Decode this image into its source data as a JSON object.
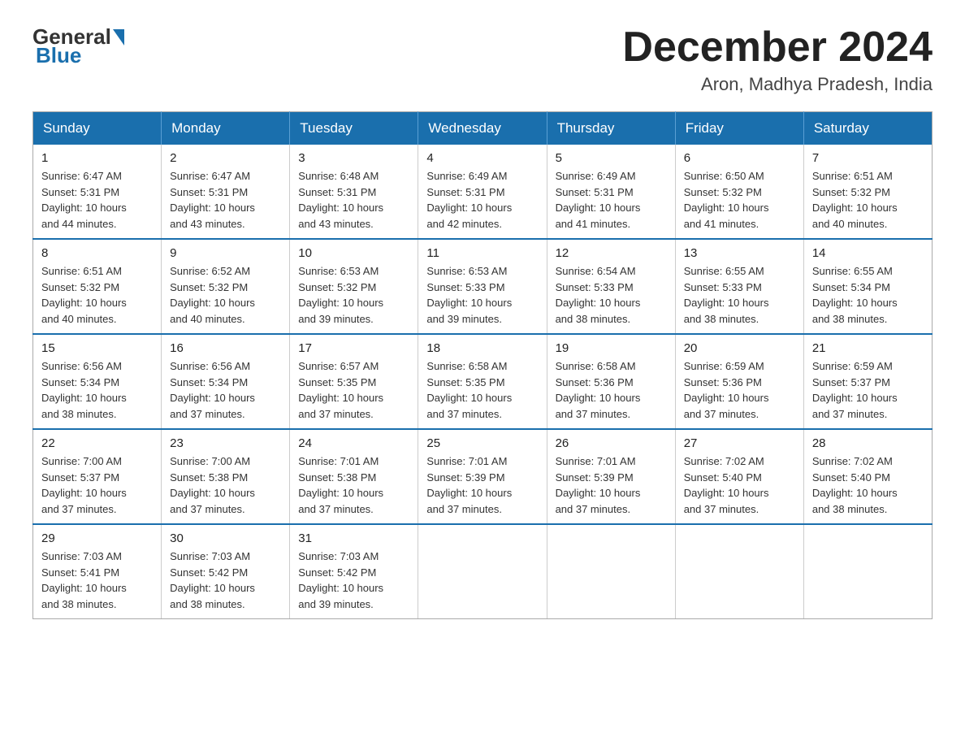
{
  "header": {
    "logo_general": "General",
    "logo_blue": "Blue",
    "month_title": "December 2024",
    "location": "Aron, Madhya Pradesh, India"
  },
  "weekdays": [
    "Sunday",
    "Monday",
    "Tuesday",
    "Wednesday",
    "Thursday",
    "Friday",
    "Saturday"
  ],
  "weeks": [
    [
      {
        "day": "1",
        "sunrise": "6:47 AM",
        "sunset": "5:31 PM",
        "daylight": "10 hours and 44 minutes."
      },
      {
        "day": "2",
        "sunrise": "6:47 AM",
        "sunset": "5:31 PM",
        "daylight": "10 hours and 43 minutes."
      },
      {
        "day": "3",
        "sunrise": "6:48 AM",
        "sunset": "5:31 PM",
        "daylight": "10 hours and 43 minutes."
      },
      {
        "day": "4",
        "sunrise": "6:49 AM",
        "sunset": "5:31 PM",
        "daylight": "10 hours and 42 minutes."
      },
      {
        "day": "5",
        "sunrise": "6:49 AM",
        "sunset": "5:31 PM",
        "daylight": "10 hours and 41 minutes."
      },
      {
        "day": "6",
        "sunrise": "6:50 AM",
        "sunset": "5:32 PM",
        "daylight": "10 hours and 41 minutes."
      },
      {
        "day": "7",
        "sunrise": "6:51 AM",
        "sunset": "5:32 PM",
        "daylight": "10 hours and 40 minutes."
      }
    ],
    [
      {
        "day": "8",
        "sunrise": "6:51 AM",
        "sunset": "5:32 PM",
        "daylight": "10 hours and 40 minutes."
      },
      {
        "day": "9",
        "sunrise": "6:52 AM",
        "sunset": "5:32 PM",
        "daylight": "10 hours and 40 minutes."
      },
      {
        "day": "10",
        "sunrise": "6:53 AM",
        "sunset": "5:32 PM",
        "daylight": "10 hours and 39 minutes."
      },
      {
        "day": "11",
        "sunrise": "6:53 AM",
        "sunset": "5:33 PM",
        "daylight": "10 hours and 39 minutes."
      },
      {
        "day": "12",
        "sunrise": "6:54 AM",
        "sunset": "5:33 PM",
        "daylight": "10 hours and 38 minutes."
      },
      {
        "day": "13",
        "sunrise": "6:55 AM",
        "sunset": "5:33 PM",
        "daylight": "10 hours and 38 minutes."
      },
      {
        "day": "14",
        "sunrise": "6:55 AM",
        "sunset": "5:34 PM",
        "daylight": "10 hours and 38 minutes."
      }
    ],
    [
      {
        "day": "15",
        "sunrise": "6:56 AM",
        "sunset": "5:34 PM",
        "daylight": "10 hours and 38 minutes."
      },
      {
        "day": "16",
        "sunrise": "6:56 AM",
        "sunset": "5:34 PM",
        "daylight": "10 hours and 37 minutes."
      },
      {
        "day": "17",
        "sunrise": "6:57 AM",
        "sunset": "5:35 PM",
        "daylight": "10 hours and 37 minutes."
      },
      {
        "day": "18",
        "sunrise": "6:58 AM",
        "sunset": "5:35 PM",
        "daylight": "10 hours and 37 minutes."
      },
      {
        "day": "19",
        "sunrise": "6:58 AM",
        "sunset": "5:36 PM",
        "daylight": "10 hours and 37 minutes."
      },
      {
        "day": "20",
        "sunrise": "6:59 AM",
        "sunset": "5:36 PM",
        "daylight": "10 hours and 37 minutes."
      },
      {
        "day": "21",
        "sunrise": "6:59 AM",
        "sunset": "5:37 PM",
        "daylight": "10 hours and 37 minutes."
      }
    ],
    [
      {
        "day": "22",
        "sunrise": "7:00 AM",
        "sunset": "5:37 PM",
        "daylight": "10 hours and 37 minutes."
      },
      {
        "day": "23",
        "sunrise": "7:00 AM",
        "sunset": "5:38 PM",
        "daylight": "10 hours and 37 minutes."
      },
      {
        "day": "24",
        "sunrise": "7:01 AM",
        "sunset": "5:38 PM",
        "daylight": "10 hours and 37 minutes."
      },
      {
        "day": "25",
        "sunrise": "7:01 AM",
        "sunset": "5:39 PM",
        "daylight": "10 hours and 37 minutes."
      },
      {
        "day": "26",
        "sunrise": "7:01 AM",
        "sunset": "5:39 PM",
        "daylight": "10 hours and 37 minutes."
      },
      {
        "day": "27",
        "sunrise": "7:02 AM",
        "sunset": "5:40 PM",
        "daylight": "10 hours and 37 minutes."
      },
      {
        "day": "28",
        "sunrise": "7:02 AM",
        "sunset": "5:40 PM",
        "daylight": "10 hours and 38 minutes."
      }
    ],
    [
      {
        "day": "29",
        "sunrise": "7:03 AM",
        "sunset": "5:41 PM",
        "daylight": "10 hours and 38 minutes."
      },
      {
        "day": "30",
        "sunrise": "7:03 AM",
        "sunset": "5:42 PM",
        "daylight": "10 hours and 38 minutes."
      },
      {
        "day": "31",
        "sunrise": "7:03 AM",
        "sunset": "5:42 PM",
        "daylight": "10 hours and 39 minutes."
      },
      null,
      null,
      null,
      null
    ]
  ],
  "labels": {
    "sunrise": "Sunrise:",
    "sunset": "Sunset:",
    "daylight": "Daylight:"
  }
}
